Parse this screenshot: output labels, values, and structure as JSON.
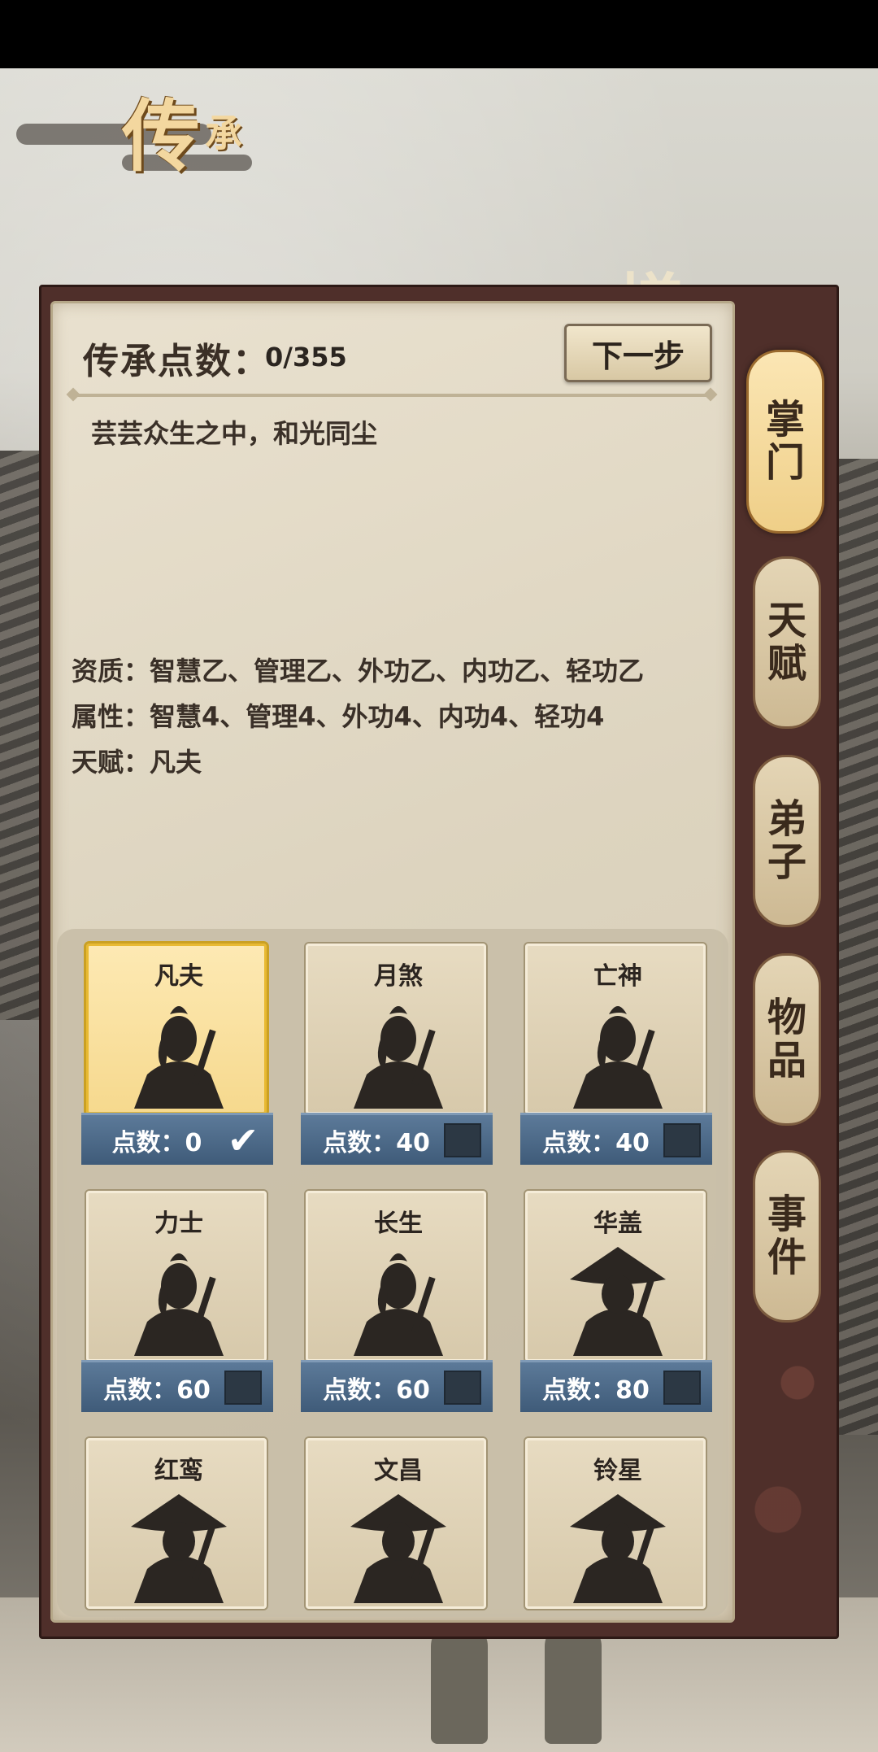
{
  "title": {
    "big": "传",
    "small": "承"
  },
  "background_sign": "搓",
  "header": {
    "points_label": "传承点数：",
    "points_value": "0/355",
    "next_button": "下一步"
  },
  "motto": "芸芸众生之中，和光同尘",
  "info": {
    "aptitude": "资质：智慧乙、管理乙、外功乙、内功乙、轻功乙",
    "attributes": "属性：智慧4、管理4、外功4、内功4、轻功4",
    "talent": "天赋：凡夫"
  },
  "cards": [
    {
      "name": "凡夫",
      "cost": "点数：0",
      "selected": true,
      "hat": false
    },
    {
      "name": "月煞",
      "cost": "点数：40",
      "selected": false,
      "hat": false
    },
    {
      "name": "亡神",
      "cost": "点数：40",
      "selected": false,
      "hat": false
    },
    {
      "name": "力士",
      "cost": "点数：60",
      "selected": false,
      "hat": false
    },
    {
      "name": "长生",
      "cost": "点数：60",
      "selected": false,
      "hat": false
    },
    {
      "name": "华盖",
      "cost": "点数：80",
      "selected": false,
      "hat": true
    },
    {
      "name": "红鸾",
      "cost": "",
      "selected": false,
      "hat": true
    },
    {
      "name": "文昌",
      "cost": "",
      "selected": false,
      "hat": true
    },
    {
      "name": "铃星",
      "cost": "",
      "selected": false,
      "hat": true
    }
  ],
  "tabs": [
    {
      "top": "掌",
      "bottom": "门",
      "active": true
    },
    {
      "top": "天",
      "bottom": "赋",
      "active": false
    },
    {
      "top": "弟",
      "bottom": "子",
      "active": false
    },
    {
      "top": "物",
      "bottom": "品",
      "active": false
    },
    {
      "top": "事",
      "bottom": "件",
      "active": false
    }
  ],
  "checkmark": "✔",
  "colors": {
    "frame": "#4f2f2a",
    "paper": "#e3dac6",
    "selected_card": "#f6d98e",
    "cost_bar": "#4a6786"
  }
}
